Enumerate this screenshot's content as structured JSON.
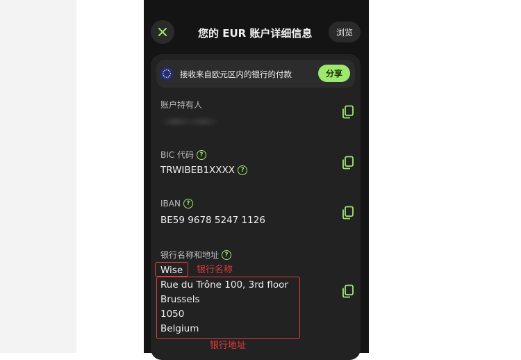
{
  "header": {
    "title": "您的 EUR 账户详细信息",
    "browse_label": "浏览"
  },
  "banner": {
    "text": "接收来自欧元区内的银行的付款",
    "share_label": "分享"
  },
  "fields": {
    "holder": {
      "label": "账户持有人"
    },
    "bic": {
      "label": "BIC 代码",
      "value": "TRWIBEB1XXXX"
    },
    "iban": {
      "label": "IBAN",
      "value": "BE59 9678 5247 1126"
    },
    "bank": {
      "label": "银行名称和地址",
      "name": "Wise",
      "address": [
        "Rue du Trône 100, 3rd floor",
        "Brussels",
        "1050",
        "Belgium"
      ]
    }
  },
  "annotations": {
    "bank_name": "银行名称",
    "bank_address": "银行地址"
  },
  "colors": {
    "accent": "#9fe870",
    "annotation": "#e23b3b",
    "background": "#141414",
    "card": "#222222"
  }
}
